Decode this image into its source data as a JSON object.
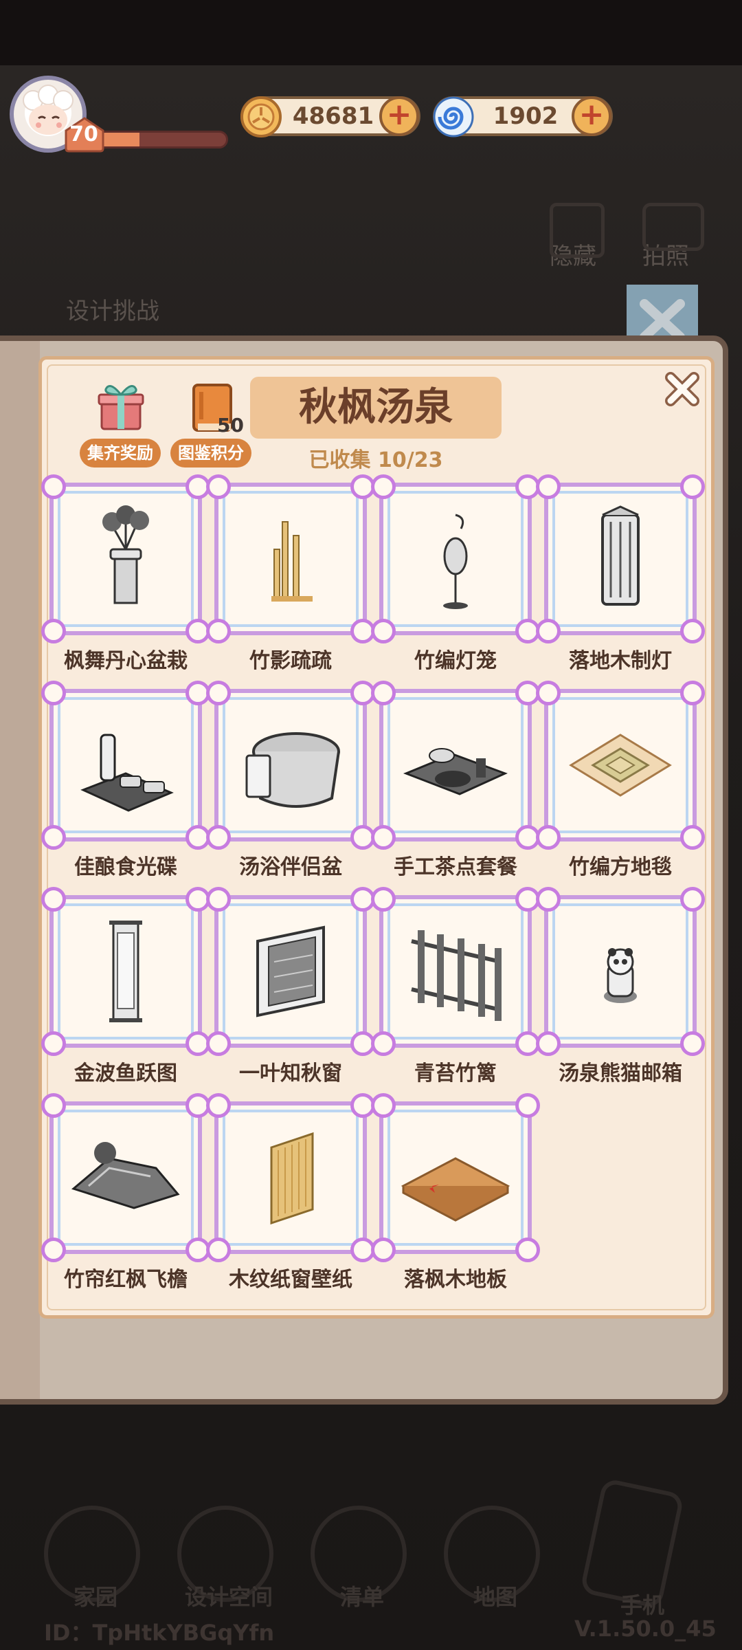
{
  "player": {
    "level": "70",
    "xp_fraction": 0.32
  },
  "currencies": [
    {
      "name": "gold-coin",
      "value": "48681"
    },
    {
      "name": "blue-swirl-gem",
      "value": "1902"
    }
  ],
  "background": {
    "hints": [
      "隐藏",
      "拍照",
      "设计挑战"
    ],
    "nav": [
      {
        "label": "家园",
        "icon": "home-icon"
      },
      {
        "label": "设计空间",
        "icon": "design-icon"
      },
      {
        "label": "清单",
        "icon": "list-icon"
      },
      {
        "label": "地图",
        "icon": "map-pin-icon"
      },
      {
        "label": "手机",
        "icon": "phone-icon"
      }
    ],
    "id_text": "ID：TpHtkYBGqYfn",
    "version": "V.1.50.0_45"
  },
  "collection": {
    "title": "秋枫汤泉",
    "collected": "已收集 10/23",
    "gift_label": "集齐奖励",
    "book_label": "图鉴积分",
    "book_score": "50",
    "items": [
      {
        "name": "枫舞丹心盆栽",
        "icon": "bonsai-icon"
      },
      {
        "name": "竹影疏疏",
        "icon": "bamboo-icon"
      },
      {
        "name": "竹编灯笼",
        "icon": "lantern-icon"
      },
      {
        "name": "落地木制灯",
        "icon": "floor-lamp-icon"
      },
      {
        "name": "佳酿食光碟",
        "icon": "sake-tray-icon"
      },
      {
        "name": "汤浴伴侣盆",
        "icon": "bath-tub-icon"
      },
      {
        "name": "手工茶点套餐",
        "icon": "tea-set-icon"
      },
      {
        "name": "竹编方地毯",
        "icon": "square-rug-icon"
      },
      {
        "name": "金波鱼跃图",
        "icon": "hanging-scroll-icon"
      },
      {
        "name": "一叶知秋窗",
        "icon": "window-icon"
      },
      {
        "name": "青苔竹篱",
        "icon": "bamboo-fence-icon"
      },
      {
        "name": "汤泉熊猫邮箱",
        "icon": "panda-mailbox-icon"
      },
      {
        "name": "竹帘红枫飞檐",
        "icon": "eaves-roof-icon"
      },
      {
        "name": "木纹纸窗壁纸",
        "icon": "paper-wallpaper-icon"
      },
      {
        "name": "落枫木地板",
        "icon": "wood-floor-icon"
      }
    ]
  },
  "colors": {
    "accent": "#d8833f",
    "title_bg": "#efc496",
    "frame": "#c77ce0"
  }
}
